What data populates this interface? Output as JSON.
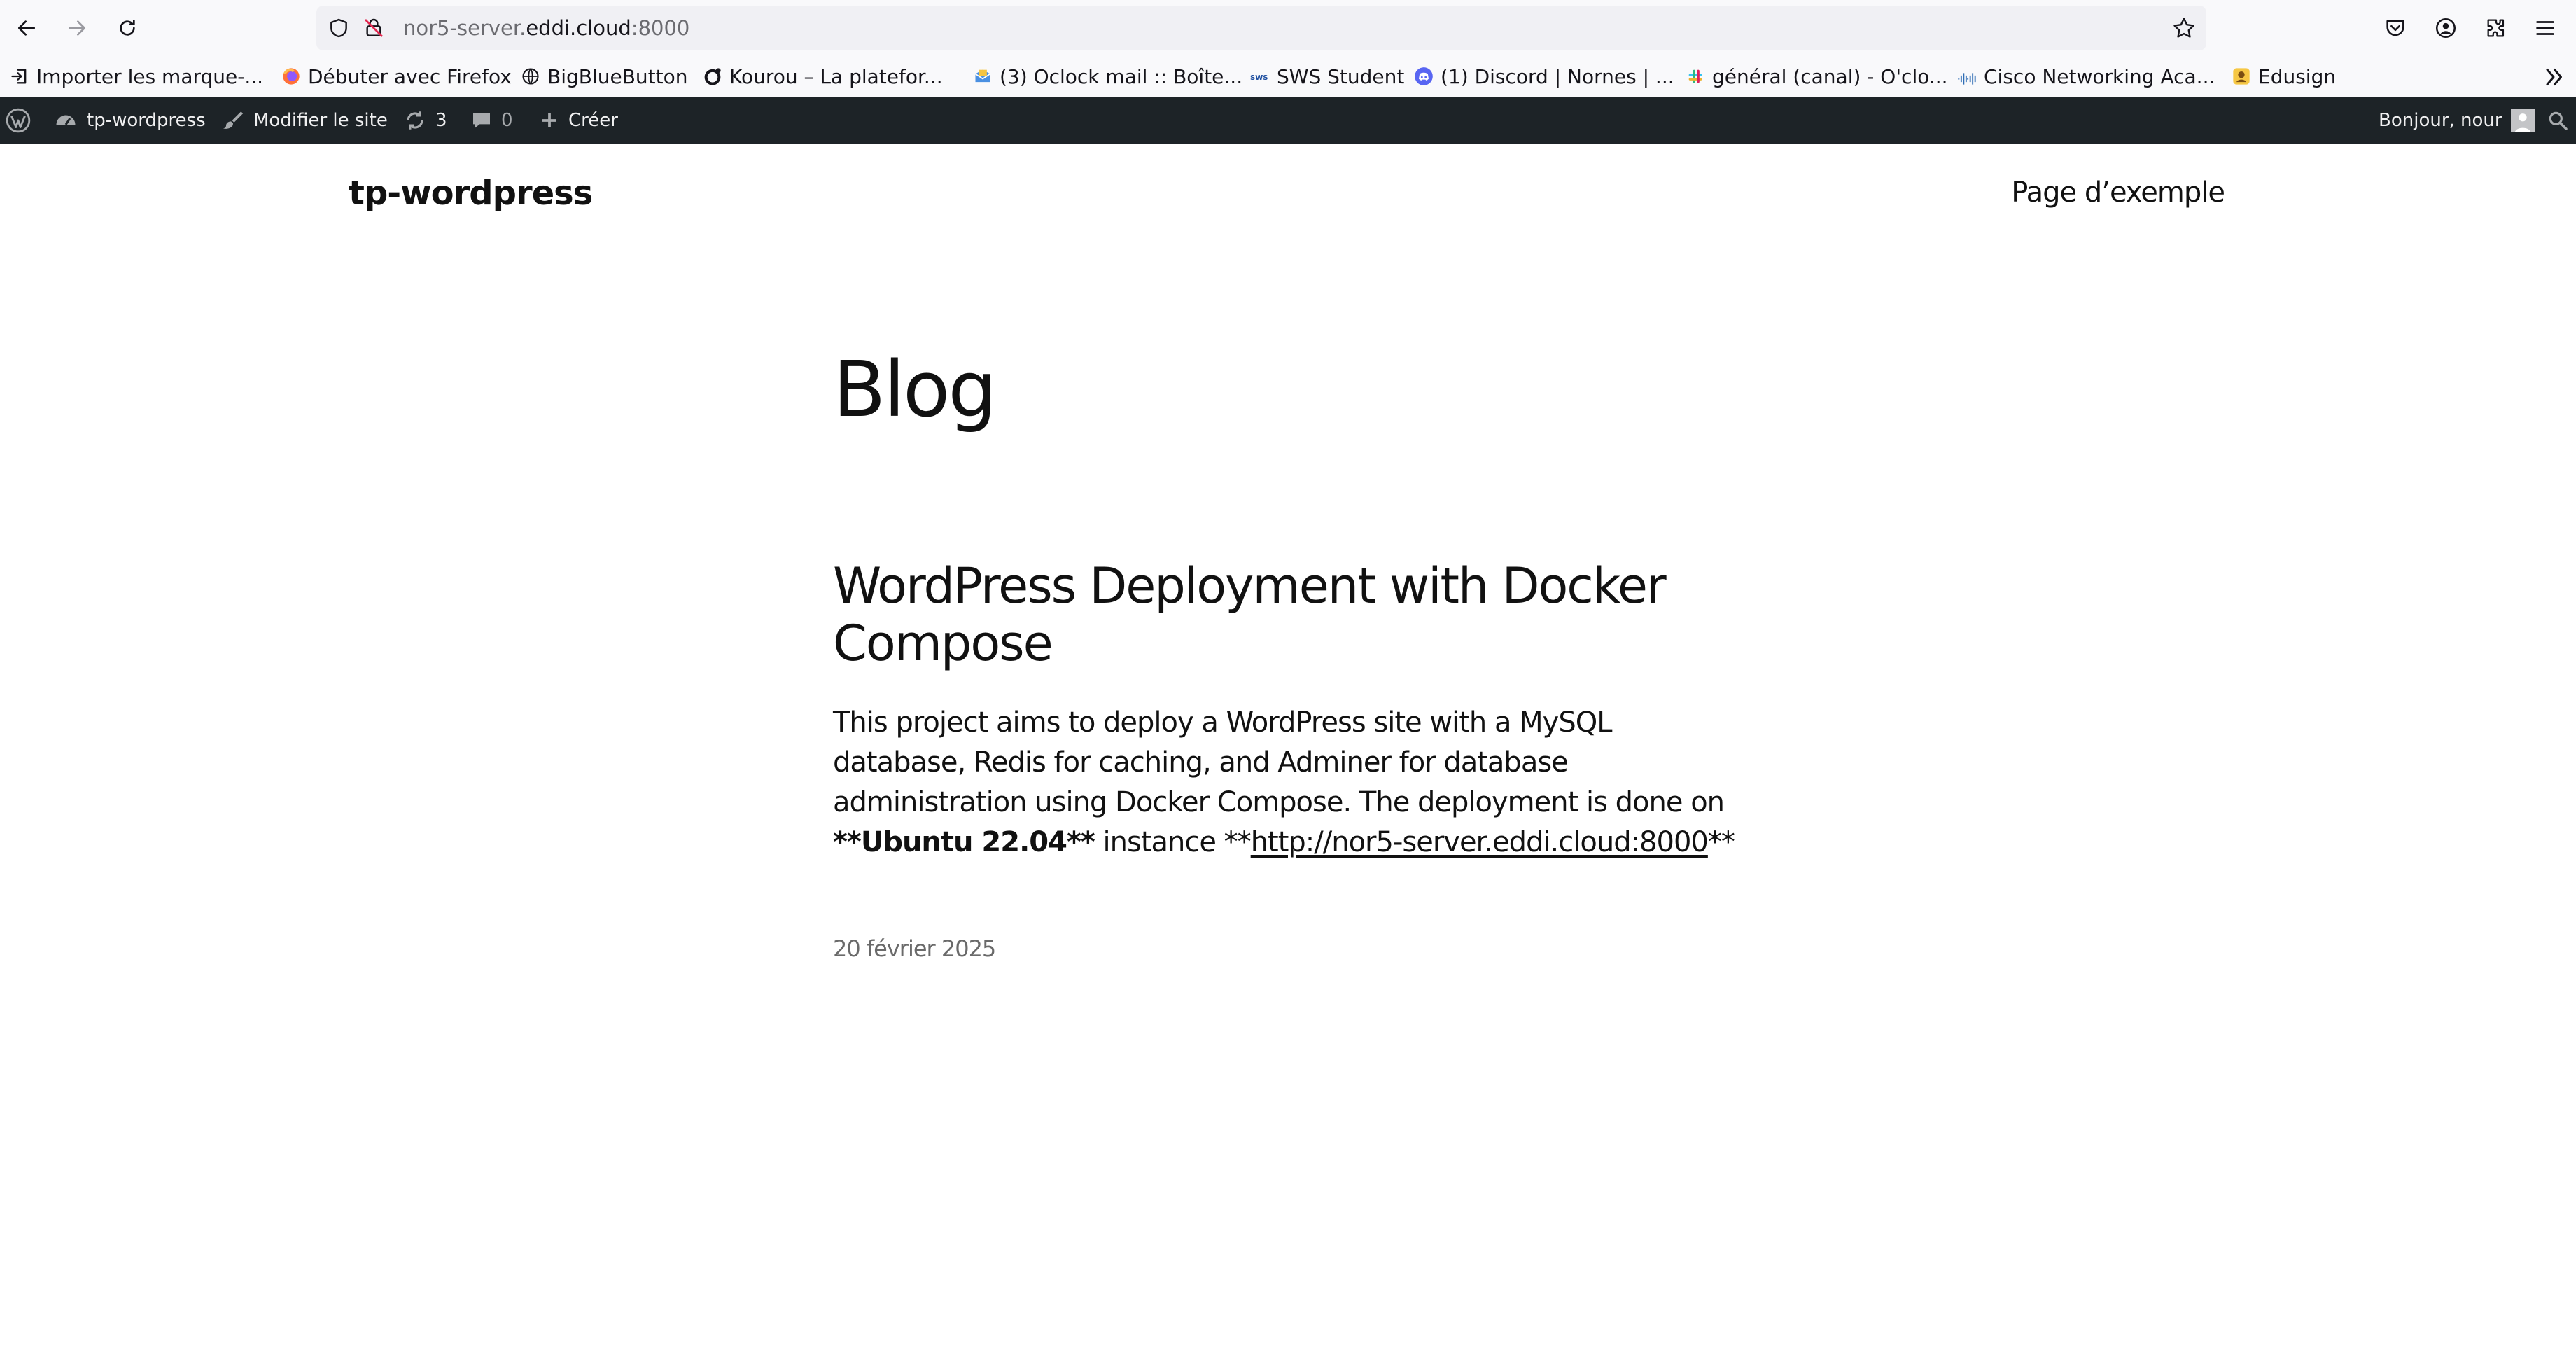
{
  "browser": {
    "url_prefix": "nor5-server.",
    "url_domain": "eddi.cloud",
    "url_suffix": ":8000"
  },
  "bookmarks": [
    {
      "label": "Importer les marque-...",
      "icon": "import-icon"
    },
    {
      "label": "Débuter avec Firefox",
      "icon": "firefox-icon"
    },
    {
      "label": "BigBlueButton",
      "icon": "globe-icon"
    },
    {
      "label": "Kourou – La platefor...",
      "icon": "kourou-icon"
    },
    {
      "label": "(3) Oclock mail :: Boîte...",
      "icon": "mail-icon"
    },
    {
      "label": "SWS Student",
      "icon": "sws-icon"
    },
    {
      "label": "(1) Discord | Nornes | ...",
      "icon": "discord-icon"
    },
    {
      "label": "général (canal) - O'clo...",
      "icon": "slack-icon"
    },
    {
      "label": "Cisco Networking Aca...",
      "icon": "cisco-icon"
    },
    {
      "label": "Edusign",
      "icon": "edusign-icon"
    }
  ],
  "adminbar": {
    "site_name": "tp-wordpress",
    "edit_site": "Modifier le site",
    "updates_count": "3",
    "comments_count": "0",
    "create": "Créer",
    "greeting": "Bonjour, nour"
  },
  "site": {
    "title": "tp-wordpress",
    "nav_page": "Page d’exemple"
  },
  "main": {
    "heading": "Blog",
    "post": {
      "title": "WordPress Deployment with Docker Compose",
      "excerpt_text": "This project aims to deploy a WordPress site with a MySQL database, Redis for caching, and Adminer for database administration using Docker Compose. The deployment is done on ",
      "excerpt_bold": "**Ubuntu 22.04**",
      "excerpt_mid": " instance **",
      "excerpt_link": "http://nor5-server.eddi.cloud:8000",
      "excerpt_end": "**",
      "date": "20 février 2025"
    }
  },
  "colors": {
    "adminbar_bg": "#1d2327",
    "toolbar_bg": "#f9f9fb",
    "urlbar_bg": "#f0f0f4",
    "text": "#111111",
    "date": "#6a6a6a"
  }
}
